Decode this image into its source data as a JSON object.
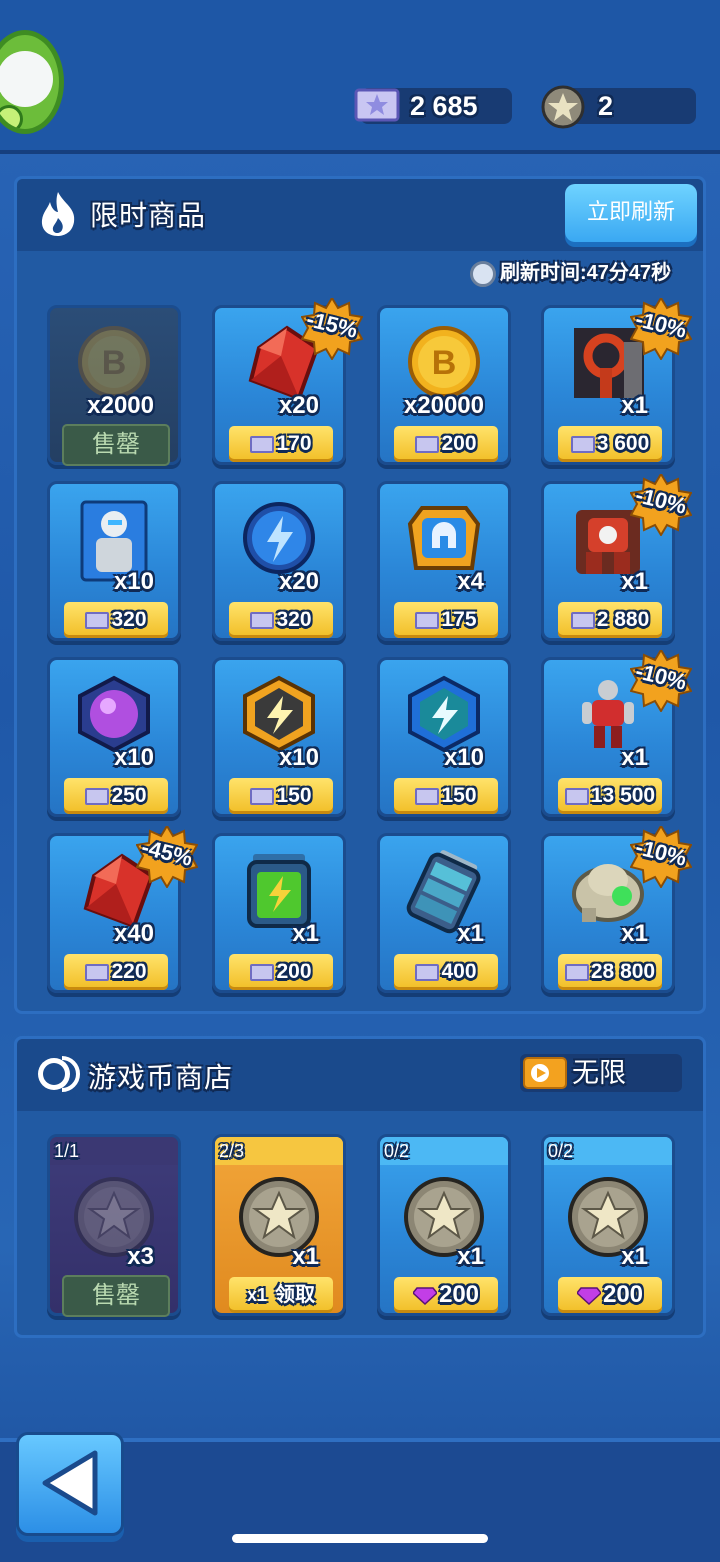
{
  "header": {
    "tickets": "2 685",
    "stars": "2"
  },
  "limited": {
    "title": "限时商品",
    "refresh_button": "立即刷新",
    "refresh_label": "刷新时间:",
    "refresh_time": "47分47秒",
    "items": [
      {
        "icon": "coin-b-icon",
        "qty": "x2000",
        "price": null,
        "discount": null,
        "sold": true
      },
      {
        "icon": "red-gem-icon",
        "qty": "x20",
        "price": "170",
        "discount": "-15%"
      },
      {
        "icon": "coin-b-icon",
        "qty": "x20000",
        "price": "200",
        "discount": null
      },
      {
        "icon": "robot-part-icon",
        "qty": "x1",
        "price": "3 600",
        "discount": "-10%"
      },
      {
        "icon": "mech-card-icon",
        "qty": "x10",
        "price": "320",
        "discount": null
      },
      {
        "icon": "lightning-orb-icon",
        "qty": "x20",
        "price": "320",
        "discount": null
      },
      {
        "icon": "helmet-chest-icon",
        "qty": "x4",
        "price": "175",
        "discount": null
      },
      {
        "icon": "red-robot-icon",
        "qty": "x1",
        "price": "2 880",
        "discount": "-10%"
      },
      {
        "icon": "purple-orb-icon",
        "qty": "x10",
        "price": "250",
        "discount": null
      },
      {
        "icon": "gold-lightning-hex-icon",
        "qty": "x10",
        "price": "150",
        "discount": null
      },
      {
        "icon": "blue-lightning-hex-icon",
        "qty": "x10",
        "price": "150",
        "discount": null
      },
      {
        "icon": "red-mech-figure-icon",
        "qty": "x1",
        "price": "13 500",
        "discount": "-10%"
      },
      {
        "icon": "red-gem-icon",
        "qty": "x40",
        "price": "220",
        "discount": "-45%"
      },
      {
        "icon": "battery-green-icon",
        "qty": "x1",
        "price": "200",
        "discount": null
      },
      {
        "icon": "battery-blue-icon",
        "qty": "x1",
        "price": "400",
        "discount": null
      },
      {
        "icon": "stone-beast-icon",
        "qty": "x1",
        "price": "28 800",
        "discount": "-10%"
      }
    ],
    "sold_label": "售罄"
  },
  "coinstore": {
    "title": "游戏币商店",
    "unlimited": "无限",
    "slots": [
      {
        "count": "1/1",
        "qty": "x3",
        "sold": true,
        "sold_label": "售罄"
      },
      {
        "count": "2/3",
        "qty": "x1",
        "claim_count": "x1",
        "claim_label": "领取"
      },
      {
        "count": "0/2",
        "qty": "x1",
        "price": "200"
      },
      {
        "count": "0/2",
        "qty": "x1",
        "price": "200"
      }
    ]
  },
  "colors": {
    "accent_yellow": "#f1bd25",
    "panel": "#215aa3",
    "button_blue": "#3aa8f2"
  }
}
